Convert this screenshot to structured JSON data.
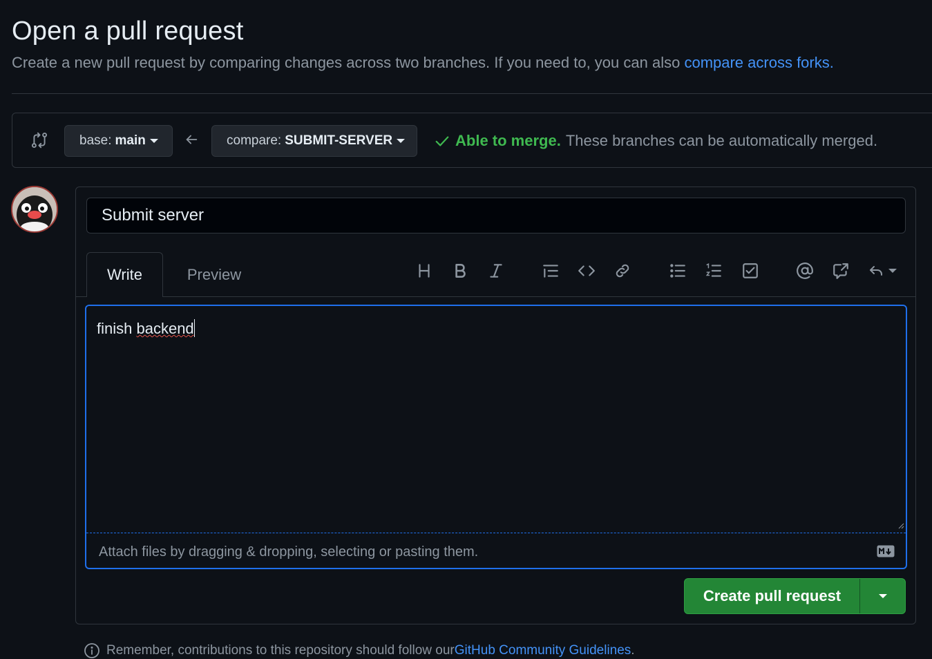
{
  "header": {
    "title": "Open a pull request",
    "subtitle_text": "Create a new pull request by comparing changes across two branches. If you need to, you can also ",
    "subtitle_link": "compare across forks."
  },
  "range": {
    "base_prefix": "base:",
    "base_branch": "main",
    "compare_prefix": "compare:",
    "compare_branch": "SUBMIT-SERVER",
    "merge_ok": "Able to merge.",
    "merge_msg": "These branches can be automatically merged."
  },
  "form": {
    "title_value": "Submit server",
    "tabs": {
      "write": "Write",
      "preview": "Preview"
    },
    "toolbar_icons": [
      "heading-icon",
      "bold-icon",
      "italic-icon",
      "quote-icon",
      "code-icon",
      "link-icon",
      "unordered-list-icon",
      "ordered-list-icon",
      "task-list-icon",
      "mention-icon",
      "reference-icon",
      "undo-icon"
    ],
    "body_word1": "finish ",
    "body_word2": "backend",
    "attach_text": "Attach files by dragging & dropping, selecting or pasting them.",
    "create_label": "Create pull request"
  },
  "footer": {
    "text": "Remember, contributions to this repository should follow our ",
    "link": "GitHub Community Guidelines",
    "end": "."
  },
  "colors": {
    "background": "#0d1117",
    "accent": "#1f6feb",
    "link": "#4493f8",
    "success": "#3fb950",
    "button_green": "#238636"
  }
}
